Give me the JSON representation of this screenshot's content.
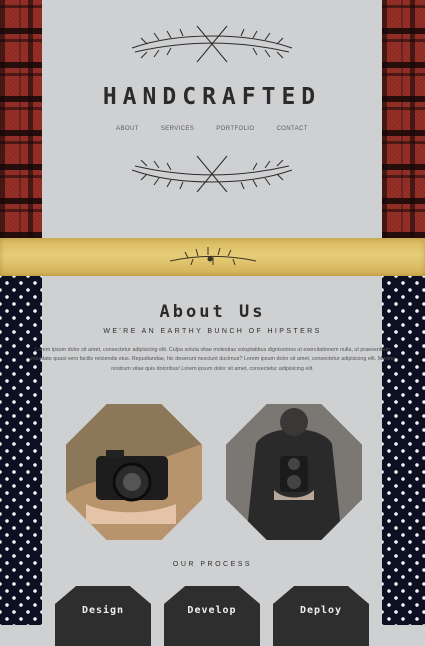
{
  "brand": {
    "title": "HANDCRAFTED"
  },
  "nav": {
    "items": [
      "ABOUT",
      "SERVICES",
      "PORTFOLIO",
      "CONTACT"
    ]
  },
  "about": {
    "title": "About Us",
    "subtitle": "WE'RE AN EARTHY BUNCH OF HIPSTERS",
    "body": "Lorem ipsum dolor sit amet, consectetur adipisicing elit. Culpa soluta vitae molestias voluptatibus dignissimos ut exercitationem nulla, ut praesentium voluptate quasi vero facilis reiciendis eius. Repudiandae, hic deserunt nesciunt ducimus? Lorem ipsum dolor sit amet, consectetur adipisicing elit. Minima nostrum vitae quis doloribus! Lorem ipsum dolor sit amet, consectetur adipisicing elit."
  },
  "process": {
    "title": "OUR PROCESS",
    "steps": [
      "Design",
      "Develop",
      "Deploy"
    ]
  },
  "colors": {
    "panel": "#cfd0d2",
    "plaid": "#8e2a22",
    "gold": "#d7b85d",
    "navy": "#0d0f22",
    "step": "#2e2e2e"
  },
  "icons": {
    "wreath": "branch-wreath-icon",
    "sprig": "herb-sprig-icon"
  }
}
